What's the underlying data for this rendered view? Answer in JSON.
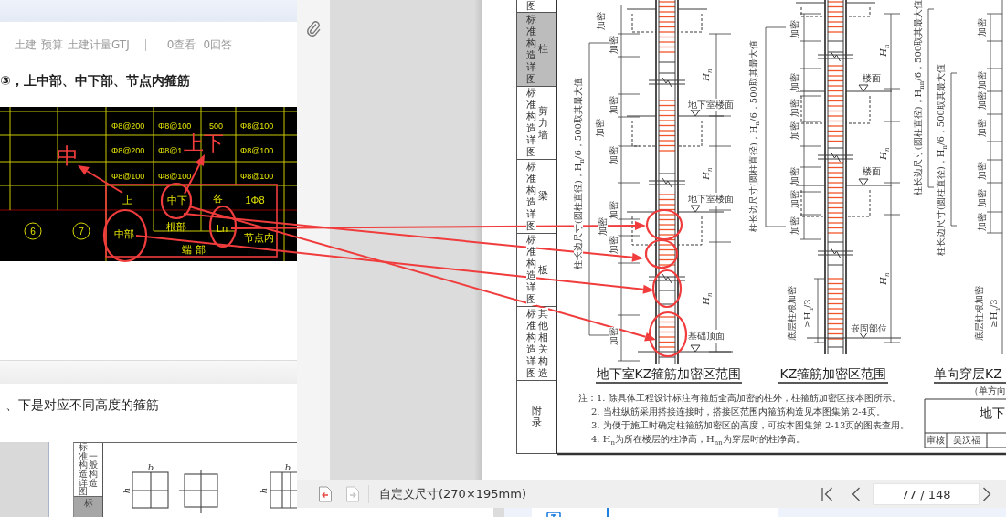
{
  "post": {
    "breadcrumb": [
      "土建",
      "预算",
      "土建计量GTJ"
    ],
    "views": "0查看",
    "answers": "0回答",
    "title": "③，上中部、中下部、节点内箍筋"
  },
  "cad_image": {
    "rows": [
      {
        "column_1": "Φ8@200",
        "column_2": "Φ8@100",
        "column_3": "500",
        "column_4": "Φ8@100"
      },
      {
        "column_1": "Φ8@200",
        "column_2": "Φ8@1",
        "column_4": "Φ8@100"
      },
      {
        "column_1": "Φ8@100",
        "column_2": "Φ8@100",
        "column_4": "Φ8@100"
      }
    ],
    "labels": [
      "上",
      "中下",
      "各",
      "1Φ8",
      "中部",
      "根部",
      "Ln",
      "节点内",
      "端 部"
    ],
    "markers": [
      "6",
      "7"
    ],
    "annotations": [
      "中",
      "上下"
    ]
  },
  "answer": {
    "text": "、下是对应不同高度的箍筋",
    "figure": {
      "side_tabs": [
        {
          "prefix": "标准构造详图",
          "label": "一般构造",
          "selected": false
        },
        {
          "prefix": "标",
          "selected": true
        }
      ],
      "dimension_labels": [
        "b",
        "h",
        "b",
        "h"
      ]
    }
  },
  "pdf_page": {
    "side_tabs": [
      {
        "prefix": "图",
        "selected": false
      },
      {
        "prefix": "标准构造详图",
        "label": "柱",
        "selected": true
      },
      {
        "prefix": "标准构造详图",
        "label": "剪力墙",
        "selected": false
      },
      {
        "prefix": "标准构造详图",
        "label": "梁",
        "selected": false
      },
      {
        "prefix": "标准构造详图",
        "label": "板",
        "selected": false
      },
      {
        "prefix": "标准构造详图",
        "label": "其他相关构造",
        "selected": false
      },
      {
        "label": "附录",
        "selected": false
      }
    ],
    "details": [
      {
        "title": "地下室KZ箍筋加密区范围",
        "dimension_texts": [
          "柱长边尺寸(圆柱直径)，H$_{n}$/6，500取其最大值"
        ],
        "zone_labels": [
          "加密",
          "加密",
          "加密",
          "加密",
          "加密",
          "加密",
          "加密",
          "加密",
          "加密"
        ],
        "heights": [
          "H$_{n}$",
          "H$_{n}$",
          "H$_{n}$"
        ],
        "levels": [
          "地下室楼面",
          "地下室楼面",
          "基础顶面"
        ]
      },
      {
        "title": "KZ箍筋加密区范围",
        "dimension_texts": [
          "柱长边尺寸(圆柱直径)，H$_{n}$/6，500取其最大值"
        ],
        "zone_labels": [
          "加密",
          "加密",
          "加密",
          "加密",
          "加密",
          "加密",
          "加密"
        ],
        "root_zone": [
          "底层柱根加密",
          "≥H$_{n}$/3"
        ],
        "heights": [
          "H$_{n}$",
          "H$_{n}$",
          "H$_{n}$"
        ],
        "levels": [
          "楼面",
          "楼面",
          "嵌固部位"
        ]
      },
      {
        "title": "单向穿层KZ",
        "subtitle": "（单方向",
        "dimension_texts": [
          "柱长边尺寸(圆柱直径)，H$_{nn}$/6，500取其最大值",
          "柱长边尺寸(圆柱直径)，H$_{n}$/6，500取其最大值"
        ],
        "zone_labels": [
          "加密",
          "加密",
          "加密",
          "加密",
          "加密",
          "加密",
          "加密"
        ],
        "root_zone": [
          "底层柱根加密",
          "≥H$_{n}$/3"
        ]
      }
    ],
    "notes": [
      "注：1. 除具体工程设计标注有箍筋全高加密的柱外，柱箍筋加密区按本图所示。",
      "2. 当柱纵筋采用搭接连接时，搭接区范围内箍筋构造见本图集第 2-4页。",
      "3. 为便于施工时确定柱箍筋加密区的高度，可按本图集第 2-13页的图表查用。",
      "4. H$_{n}$为所在楼层的柱净高，H$_{nn}$为穿层时的柱净高。"
    ],
    "title_block": {
      "title": "地下",
      "cells": [
        "审核",
        "吴汉福"
      ]
    }
  },
  "toolbar": {
    "previous_document": {
      "disabled": false
    },
    "next_document": {
      "disabled": true
    },
    "page_size": "自定义尺寸(270×195mm)",
    "page": "77 / 148"
  }
}
